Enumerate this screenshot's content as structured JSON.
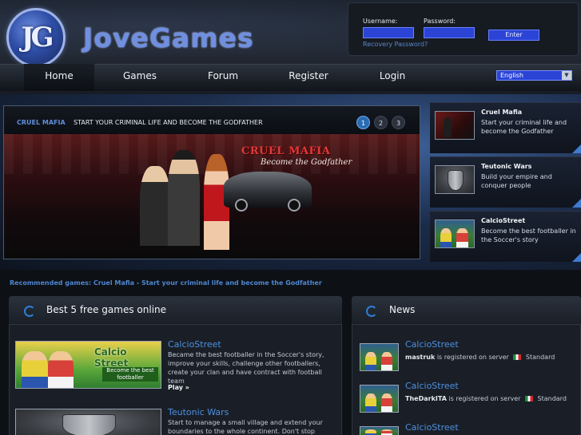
{
  "brand": {
    "name": "JoveGames",
    "mark": "JG"
  },
  "login": {
    "username_label": "Username:",
    "password_label": "Password:",
    "username_value": "",
    "password_value": "",
    "enter_label": "Enter",
    "recovery_label": "Recovery Password?"
  },
  "nav": {
    "items": [
      {
        "label": "Home",
        "active": true
      },
      {
        "label": "Games",
        "active": false
      },
      {
        "label": "Forum",
        "active": false
      },
      {
        "label": "Register",
        "active": false
      },
      {
        "label": "Login",
        "active": false
      }
    ],
    "language": "English"
  },
  "slider": {
    "game": "CRUEL MAFIA",
    "tagline": "START YOUR CRIMINAL LIFE AND BECOME THE GODFATHER",
    "pages": [
      "1",
      "2",
      "3"
    ],
    "active_page": 1,
    "art_title": "CRUEL MAFIA",
    "art_subtitle": "Become the Godfather"
  },
  "side_games": [
    {
      "title": "Cruel Mafia",
      "desc": "Start your criminal life and become the Godfather",
      "icon": "mafia-thumb"
    },
    {
      "title": "Teutonic Wars",
      "desc": "Build your empire and conquer people",
      "icon": "shield-thumb"
    },
    {
      "title": "CalcioStreet",
      "desc": "Become the best footballer in the Soccer's story",
      "icon": "soccer-thumb"
    }
  ],
  "recommended": "Recommended games: Cruel Mafia - Start your criminal life and become the Godfather",
  "top_games": {
    "title": "Best 5 free games online",
    "items": [
      {
        "title": "CalcioStreet",
        "desc": "Became the best footballer in the Soccer's story, improve your skills, challenge other footballers, create your clan and have contract with football team",
        "play": "Play »",
        "banner_title": "Calcio Street",
        "banner_sub": "Become the best footballer"
      },
      {
        "title": "Teutonic Wars",
        "desc": "Start to manage a small village and extend your boundaries to the whole continent. Don't stop before",
        "play": "",
        "banner_title": "",
        "banner_sub": ""
      }
    ]
  },
  "news": {
    "title": "News",
    "items": [
      {
        "title": "CalcioStreet",
        "user": "mastruk",
        "text": "is registered on server",
        "server": "Standard"
      },
      {
        "title": "CalcioStreet",
        "user": "TheDarkITA",
        "text": "is registered on server",
        "server": "Standard"
      },
      {
        "title": "CalcioStreet",
        "user": "",
        "text": "",
        "server": ""
      }
    ]
  },
  "colors": {
    "accent_blue": "#2b44d6",
    "link_blue": "#4d8fe0",
    "panel_bg": "#1a1f27",
    "mafia_red": "#e43838"
  }
}
